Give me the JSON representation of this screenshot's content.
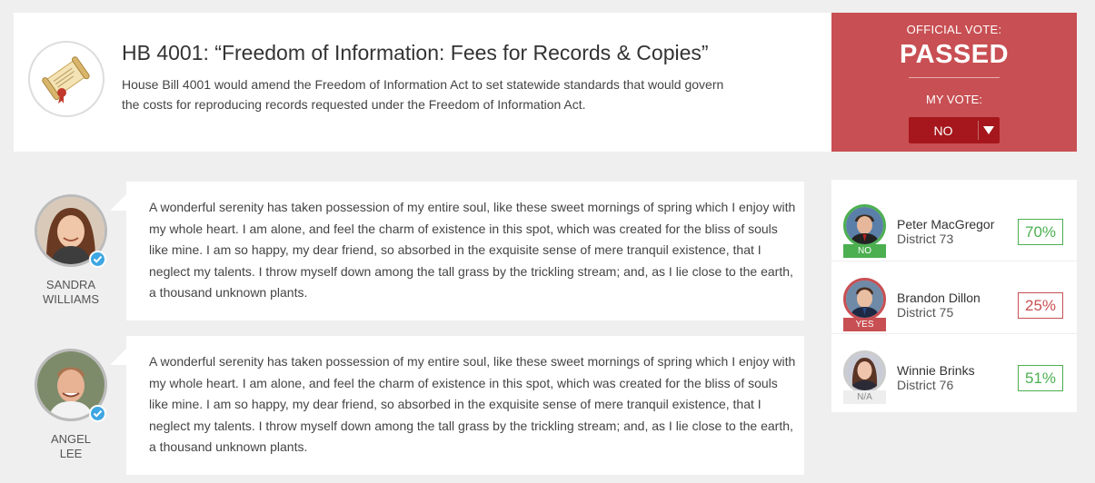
{
  "bill": {
    "title": "HB 4001: “Freedom of Information: Fees for Records & Copies”",
    "description": "House Bill 4001 would amend the Freedom of Information Act to set statewide standards that would govern the costs for reproducing records requested under the Freedom of Information Act.",
    "icon": "scroll-icon"
  },
  "vote": {
    "official_label": "OFFICIAL VOTE:",
    "official_result": "PASSED",
    "my_vote_label": "MY VOTE:",
    "my_vote_value": "NO",
    "panel_color": "#c84f53",
    "select_color": "#a5171c"
  },
  "comments": [
    {
      "name_line1": "SANDRA",
      "name_line2": "WILLIAMS",
      "verified": true,
      "text": "A wonderful serenity has taken possession of my entire soul, like these sweet mornings of spring which I enjoy with my whole heart. I am alone, and feel the charm of existence in this spot, which was created for the bliss of souls like mine. I am so happy, my dear friend, so absorbed in the exquisite sense of mere tranquil existence, that I neglect my talents.  I throw myself down among the tall grass by the trickling stream; and, as I lie close to the earth, a thousand unknown plants."
    },
    {
      "name_line1": "ANGEL",
      "name_line2": "LEE",
      "verified": true,
      "text": "A wonderful serenity has taken possession of my entire soul, like these sweet mornings of spring which I enjoy with my whole heart. I am alone, and feel the charm of existence in this spot, which was created for the bliss of souls like mine. I am so happy, my dear friend, so absorbed in the exquisite sense of mere tranquil existence, that I neglect my talents.  I throw myself down among the tall grass by the trickling stream; and, as I lie close to the earth, a thousand unknown plants."
    }
  ],
  "legislators": [
    {
      "name": "Peter MacGregor",
      "district": "District 73",
      "vote": "NO",
      "percent": "70%",
      "vote_color": "#4caf50",
      "percent_color": "#4caf50"
    },
    {
      "name": "Brandon Dillon",
      "district": "District 75",
      "vote": "YES",
      "percent": "25%",
      "vote_color": "#c84f53",
      "percent_color": "#c84f53"
    },
    {
      "name": "Winnie Brinks",
      "district": "District 76",
      "vote": "N/A",
      "percent": "51%",
      "vote_color": "#cccccc",
      "percent_color": "#4caf50"
    }
  ]
}
